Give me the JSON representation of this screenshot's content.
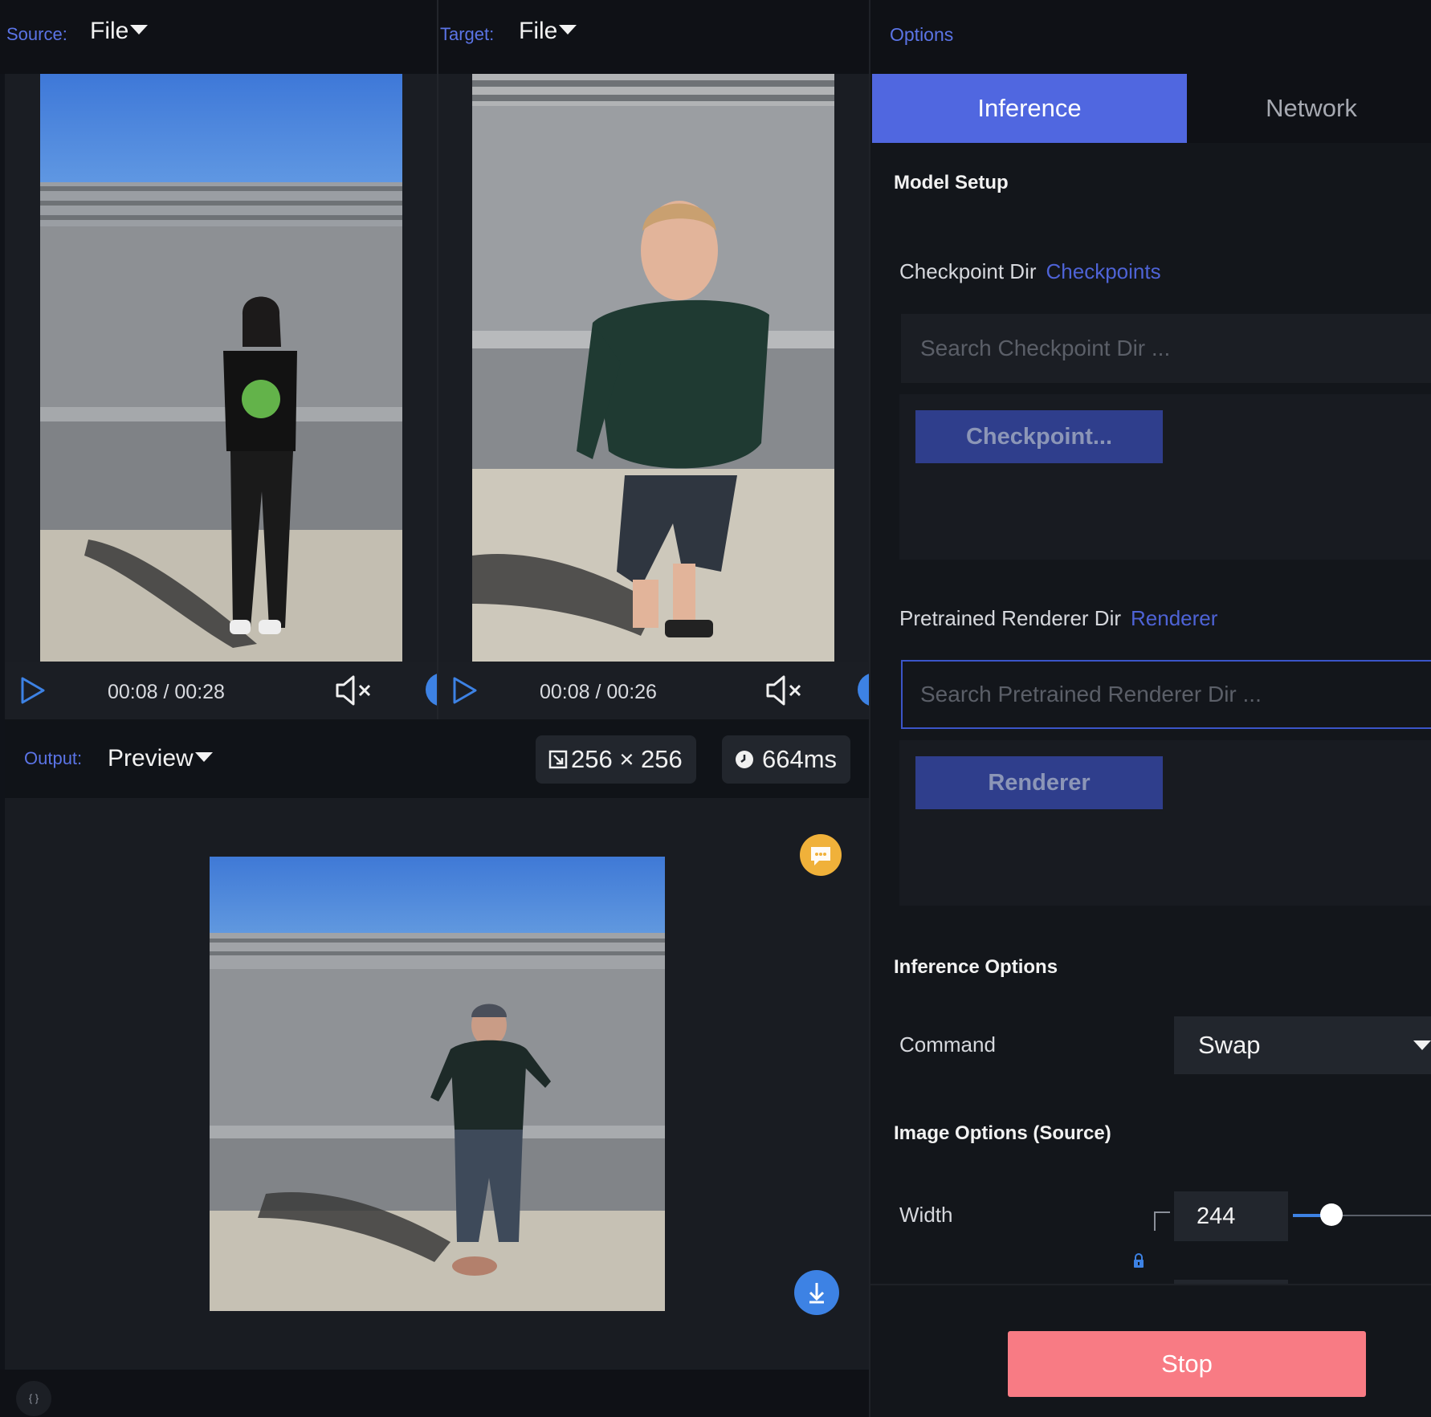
{
  "source": {
    "label": "Source:",
    "value": "File",
    "time": "00:08 / 00:28"
  },
  "target": {
    "label": "Target:",
    "value": "File",
    "time": "00:08 / 00:26"
  },
  "output": {
    "label": "Output:",
    "value": "Preview",
    "resolution": "256 × 256",
    "latency": "664ms"
  },
  "options": {
    "title": "Options",
    "tabs": [
      "Inference",
      "Network"
    ],
    "model_setup": "Model Setup",
    "checkpoint": {
      "label": "Checkpoint Dir",
      "link": "Checkpoints",
      "placeholder": "Search Checkpoint Dir ...",
      "button": "Checkpoint..."
    },
    "renderer": {
      "label": "Pretrained Renderer Dir",
      "link": "Renderer",
      "placeholder": "Search Pretrained Renderer Dir ...",
      "button": "Renderer"
    },
    "inference_options": "Inference Options",
    "command": {
      "label": "Command",
      "value": "Swap"
    },
    "image_options": "Image Options (Source)",
    "width": {
      "label": "Width",
      "value": "244",
      "slider_fraction": 0.2
    }
  },
  "stop_button": "Stop",
  "footer_icon": "{ }",
  "colors": {
    "accent": "#5067e0",
    "stop": "#f87b84",
    "badge": "#f0b13a",
    "download": "#3d82e4"
  }
}
